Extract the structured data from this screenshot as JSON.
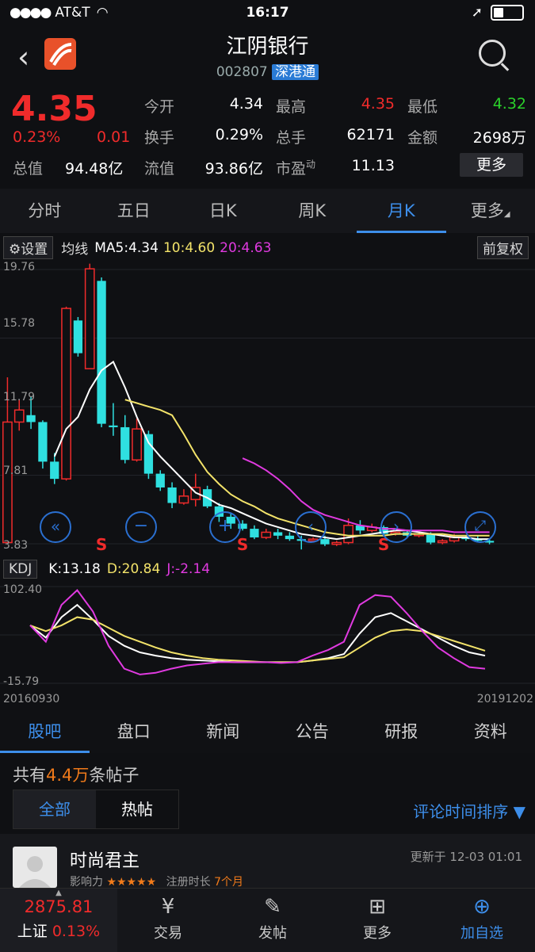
{
  "status": {
    "carrier": "AT&T",
    "time": "16:17"
  },
  "header": {
    "title": "江阴银行",
    "code": "002807",
    "tag": "深港通"
  },
  "quote": {
    "price": "4.35",
    "change_pct": "0.23%",
    "change": "0.01",
    "total_value_label": "总值",
    "total_value": "94.48亿",
    "float_value_label": "流值",
    "float_value": "93.86亿",
    "pe_label": "市盈",
    "pe_sup": "动",
    "pe": "11.13",
    "open_label": "今开",
    "open": "4.34",
    "high_label": "最高",
    "high": "4.35",
    "low_label": "最低",
    "low": "4.32",
    "turnover_label": "换手",
    "turnover": "0.29%",
    "volume_label": "总手",
    "volume": "62171",
    "amount_label": "金额",
    "amount": "2698万",
    "more_label": "更多"
  },
  "tabs": [
    "分时",
    "五日",
    "日K",
    "周K",
    "月K",
    "更多"
  ],
  "chart": {
    "settings_label": "设置",
    "ma_label": "均线",
    "ma5": "MA5:4.34",
    "ma10": "10:4.60",
    "ma20": "20:4.63",
    "adjust_label": "前复权",
    "kdj_label": "KDJ",
    "k": "K:13.18",
    "d": "D:20.84",
    "j": "J:-2.14",
    "sell_marker": "S",
    "start_date": "20160930",
    "end_date": "20191202",
    "colors": {
      "up": "#f02b2b",
      "down": "#2fe0e0",
      "ma5": "#ffffff",
      "ma10": "#f3e36a",
      "ma20": "#e03ae0"
    }
  },
  "chart_data": [
    {
      "type": "candlestick",
      "y_ticks": [
        "19.76",
        "15.78",
        "11.79",
        "7.81",
        "3.83"
      ],
      "ylim": [
        3.83,
        19.76
      ],
      "candles": [
        {
          "o": 3.9,
          "c": 10.9,
          "h": 13.5,
          "l": 3.9
        },
        {
          "o": 10.9,
          "c": 11.6,
          "h": 12.2,
          "l": 10.4
        },
        {
          "o": 11.3,
          "c": 10.9,
          "h": 12.4,
          "l": 10.5
        },
        {
          "o": 10.9,
          "c": 8.6,
          "h": 11.0,
          "l": 8.2
        },
        {
          "o": 8.6,
          "c": 7.6,
          "h": 9.1,
          "l": 7.3
        },
        {
          "o": 7.6,
          "c": 17.5,
          "h": 17.6,
          "l": 7.5
        },
        {
          "o": 16.8,
          "c": 14.9,
          "h": 17.0,
          "l": 14.7
        },
        {
          "o": 14.0,
          "c": 19.8,
          "h": 20.1,
          "l": 14.0
        },
        {
          "o": 19.1,
          "c": 10.8,
          "h": 19.3,
          "l": 10.6
        },
        {
          "o": 10.7,
          "c": 10.6,
          "h": 12.0,
          "l": 10.1
        },
        {
          "o": 10.6,
          "c": 8.7,
          "h": 11.3,
          "l": 8.5
        },
        {
          "o": 8.7,
          "c": 10.5,
          "h": 11.1,
          "l": 8.6
        },
        {
          "o": 10.2,
          "c": 7.9,
          "h": 10.4,
          "l": 7.6
        },
        {
          "o": 7.9,
          "c": 7.1,
          "h": 8.1,
          "l": 6.9
        },
        {
          "o": 7.1,
          "c": 6.2,
          "h": 7.4,
          "l": 5.9
        },
        {
          "o": 6.2,
          "c": 6.6,
          "h": 7.0,
          "l": 6.1
        },
        {
          "o": 6.4,
          "c": 7.1,
          "h": 7.9,
          "l": 6.0
        },
        {
          "o": 7.0,
          "c": 6.0,
          "h": 7.2,
          "l": 5.9
        },
        {
          "o": 6.0,
          "c": 5.4,
          "h": 6.2,
          "l": 5.1
        },
        {
          "o": 5.4,
          "c": 5.0,
          "h": 5.6,
          "l": 4.7
        },
        {
          "o": 5.0,
          "c": 4.7,
          "h": 5.2,
          "l": 4.6
        },
        {
          "o": 4.7,
          "c": 4.2,
          "h": 4.9,
          "l": 4.1
        },
        {
          "o": 4.2,
          "c": 4.5,
          "h": 4.7,
          "l": 4.1
        },
        {
          "o": 4.5,
          "c": 4.3,
          "h": 4.7,
          "l": 4.1
        },
        {
          "o": 4.3,
          "c": 4.1,
          "h": 4.5,
          "l": 4.0
        },
        {
          "o": 4.1,
          "c": 4.0,
          "h": 4.3,
          "l": 3.5
        },
        {
          "o": 4.0,
          "c": 4.1,
          "h": 4.2,
          "l": 3.9
        },
        {
          "o": 4.1,
          "c": 3.8,
          "h": 4.3,
          "l": 3.7
        },
        {
          "o": 3.8,
          "c": 3.9,
          "h": 4.0,
          "l": 3.7
        },
        {
          "o": 3.9,
          "c": 4.9,
          "h": 5.3,
          "l": 3.8
        },
        {
          "o": 4.9,
          "c": 4.6,
          "h": 5.2,
          "l": 4.4
        },
        {
          "o": 4.6,
          "c": 4.8,
          "h": 5.0,
          "l": 4.5
        },
        {
          "o": 4.8,
          "c": 4.4,
          "h": 4.9,
          "l": 4.3
        },
        {
          "o": 4.4,
          "c": 4.5,
          "h": 4.7,
          "l": 4.3
        },
        {
          "o": 4.5,
          "c": 4.3,
          "h": 4.6,
          "l": 4.2
        },
        {
          "o": 4.3,
          "c": 4.4,
          "h": 4.5,
          "l": 4.2
        },
        {
          "o": 4.4,
          "c": 3.9,
          "h": 4.5,
          "l": 3.8
        },
        {
          "o": 3.9,
          "c": 4.0,
          "h": 4.1,
          "l": 3.8
        },
        {
          "o": 4.0,
          "c": 4.2,
          "h": 4.4,
          "l": 3.9
        },
        {
          "o": 4.2,
          "c": 4.1,
          "h": 4.3,
          "l": 4.0
        },
        {
          "o": 4.1,
          "c": 4.0,
          "h": 4.3,
          "l": 3.9
        },
        {
          "o": 4.0,
          "c": 3.9,
          "h": 4.1,
          "l": 3.8
        }
      ],
      "ma5": [
        null,
        null,
        null,
        null,
        8.9,
        10.5,
        11.2,
        12.8,
        13.9,
        14.4,
        12.9,
        11.2,
        9.7,
        8.9,
        8.2,
        7.5,
        6.8,
        6.5,
        6.1,
        5.9,
        5.6,
        5.3,
        5.0,
        4.8,
        4.6,
        4.4,
        4.3,
        4.2,
        4.1,
        4.2,
        4.3,
        4.4,
        4.5,
        4.6,
        4.6,
        4.5,
        4.4,
        4.3,
        4.2,
        4.2,
        4.1,
        4.1
      ],
      "ma10": [
        null,
        null,
        null,
        null,
        null,
        null,
        null,
        null,
        null,
        null,
        12.2,
        12.0,
        11.8,
        11.6,
        11.3,
        10.2,
        9.0,
        8.0,
        7.3,
        6.7,
        6.3,
        6.0,
        5.6,
        5.3,
        5.1,
        4.9,
        4.7,
        4.5,
        4.4,
        4.3,
        4.3,
        4.3,
        4.3,
        4.4,
        4.4,
        4.4,
        4.4,
        4.4,
        4.3,
        4.3,
        4.3,
        4.3
      ],
      "ma20": [
        null,
        null,
        null,
        null,
        null,
        null,
        null,
        null,
        null,
        null,
        null,
        null,
        null,
        null,
        null,
        null,
        null,
        null,
        null,
        null,
        8.8,
        8.5,
        8.1,
        7.6,
        7.0,
        6.3,
        5.8,
        5.5,
        5.3,
        5.1,
        4.9,
        4.8,
        4.7,
        4.7,
        4.6,
        4.6,
        4.6,
        4.6,
        4.5,
        4.5,
        4.5,
        4.5
      ],
      "sell_markers": [
        8,
        20,
        32
      ]
    },
    {
      "type": "line",
      "y_ticks": [
        "102.40",
        "-15.79"
      ],
      "ylim": [
        -15.79,
        102.4
      ],
      "series": [
        {
          "name": "K",
          "values": [
            55,
            40,
            65,
            80,
            62,
            42,
            30,
            22,
            18,
            15,
            13,
            12,
            11,
            10,
            10,
            10,
            10,
            10,
            12,
            15,
            20,
            45,
            65,
            70,
            60,
            50,
            40,
            30,
            22,
            18
          ]
        },
        {
          "name": "D",
          "values": [
            55,
            48,
            55,
            65,
            62,
            52,
            42,
            35,
            28,
            22,
            18,
            15,
            13,
            12,
            11,
            10,
            10,
            10,
            12,
            14,
            16,
            28,
            40,
            48,
            50,
            48,
            42,
            36,
            30,
            24
          ]
        },
        {
          "name": "J",
          "values": [
            55,
            35,
            80,
            98,
            72,
            30,
            2,
            -5,
            -3,
            2,
            6,
            8,
            10,
            10,
            10,
            10,
            9,
            10,
            18,
            25,
            35,
            80,
            92,
            90,
            70,
            48,
            28,
            15,
            4,
            2
          ]
        }
      ]
    }
  ],
  "sections": [
    "股吧",
    "盘口",
    "新闻",
    "公告",
    "研报",
    "资料"
  ],
  "forum": {
    "count_prefix": "共有",
    "count": "4.4万",
    "count_suffix": "条帖子",
    "filter_all": "全部",
    "filter_hot": "热帖",
    "sort_label": "评论时间排序",
    "post": {
      "user": "时尚君主",
      "updated": "更新于 12-03 01:01",
      "influence_label": "影响力",
      "stars": "★★★★★",
      "reg_label": "注册时长",
      "reg_value": "7个月"
    }
  },
  "bottom": {
    "index_value": "2875.81",
    "index_name": "上证",
    "index_change": "0.13%",
    "trade": "交易",
    "post": "发帖",
    "more": "更多",
    "add": "加自选"
  }
}
